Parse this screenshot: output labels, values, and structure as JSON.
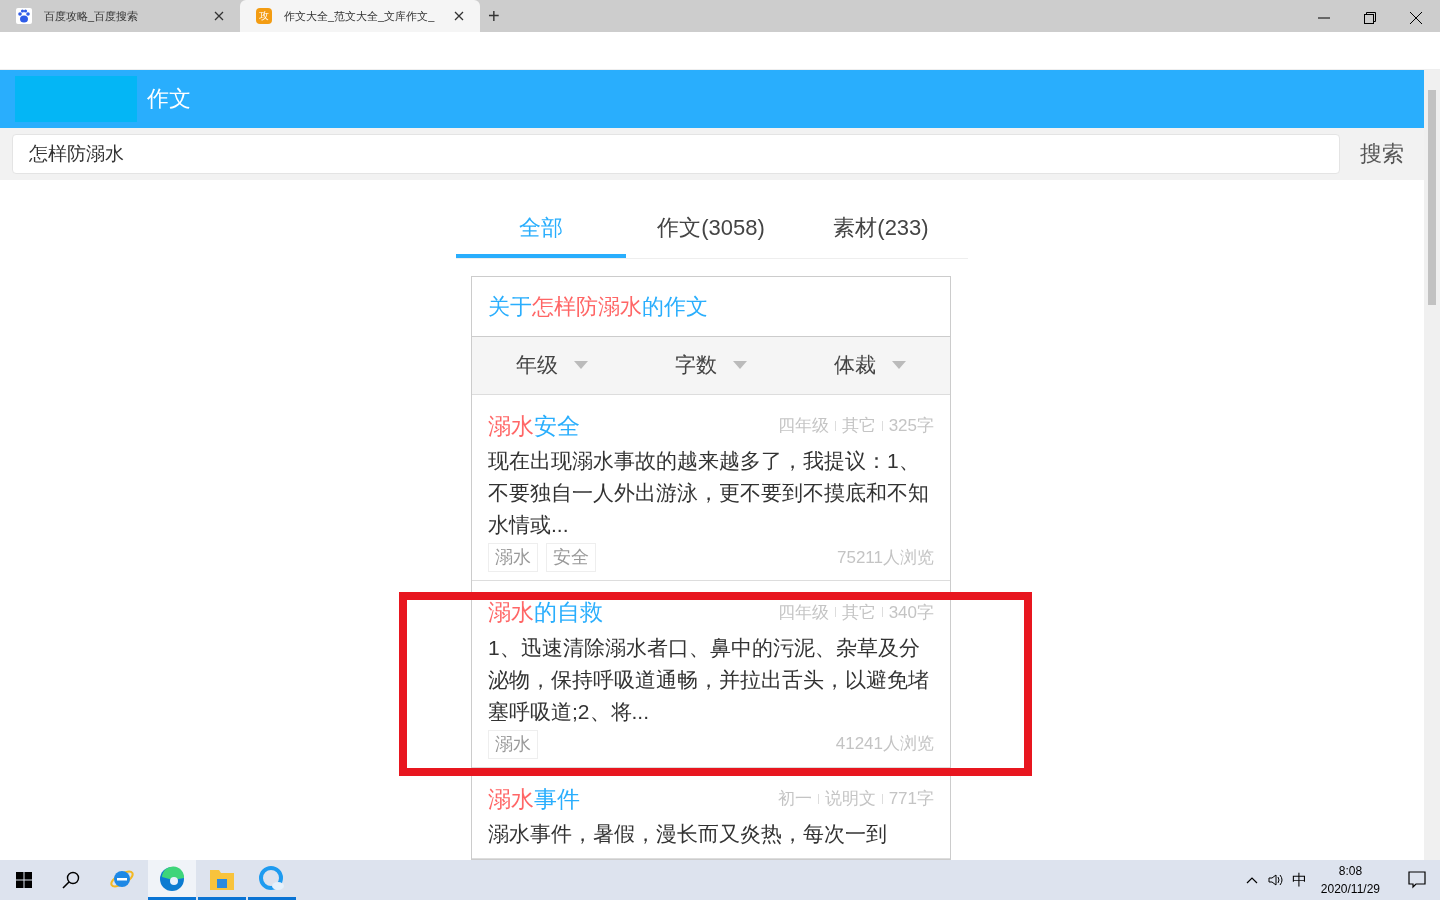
{
  "browser_tabs": [
    {
      "title": "百度攻略_百度搜索",
      "favicon": {
        "kind": "paw"
      },
      "selected": false
    },
    {
      "title": "作文大全_范文大全_文库作文_",
      "favicon": {
        "kind": "letter",
        "text": "攻"
      },
      "selected": true
    }
  ],
  "new_tab": "+",
  "site_header": {
    "title": "作文"
  },
  "search": {
    "value": "怎样防溺水",
    "button": "搜索"
  },
  "tabs": [
    {
      "label": "全部",
      "selected": true
    },
    {
      "label": "作文(3058)",
      "selected": false
    },
    {
      "label": "素材(233)",
      "selected": false
    }
  ],
  "results_heading": {
    "prefix": "关于",
    "keyword": "怎样防溺水",
    "suffix": "的作文"
  },
  "filters": [
    "年级",
    "字数",
    "体裁"
  ],
  "articles": [
    {
      "keyword": "溺水",
      "title_rest": "安全",
      "meta": [
        "四年级",
        "其它",
        "325字"
      ],
      "excerpt": "现在出现溺水事故的越来越多了，我提议：1、不要独自一人外出游泳，更不要到不摸底和不知水情或...",
      "tags": [
        "溺水",
        "安全"
      ],
      "views": "75211人浏览"
    },
    {
      "keyword": "溺水",
      "title_rest": "的自救",
      "meta": [
        "四年级",
        "其它",
        "340字"
      ],
      "excerpt": "1、迅速清除溺水者口、鼻中的污泥、杂草及分泌物，保持呼吸道通畅，并拉出舌头，以避免堵塞呼吸道;2、将...",
      "tags": [
        "溺水"
      ],
      "views": "41241人浏览"
    },
    {
      "keyword": "溺水",
      "title_rest": "事件",
      "meta": [
        "初一",
        "说明文",
        "771字"
      ],
      "excerpt": "溺水事件，暑假，漫长而又炎热，每次一到"
    }
  ],
  "highlight_frame": {
    "on": true
  },
  "taskbar": {
    "pinned": [
      {
        "kind": "ie",
        "selected": false
      },
      {
        "kind": "edge",
        "selected": true
      },
      {
        "kind": "folder",
        "selected": false
      },
      {
        "kind": "qq-browser",
        "selected": false
      }
    ],
    "ime": "中",
    "time": "8:08",
    "date": "2020/11/29"
  }
}
